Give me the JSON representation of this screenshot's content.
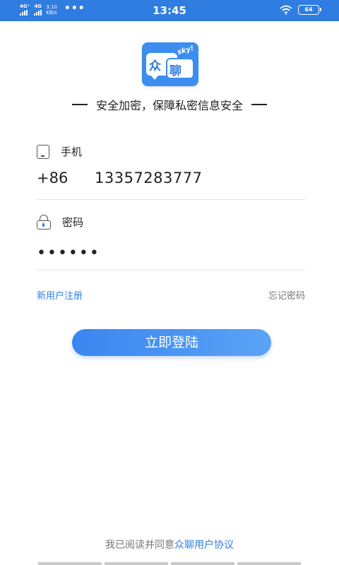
{
  "status_bar": {
    "signal1": "4G⁺",
    "signal2": "4G",
    "net_speed_value": "3.10",
    "net_speed_unit": "KB/s",
    "more": "•••",
    "time": "13:45",
    "battery": "64"
  },
  "logo": {
    "char1": "众",
    "char2": "聊",
    "sky": "sky!"
  },
  "tagline": "安全加密，保障私密信息安全",
  "phone": {
    "label": "手机",
    "country_code": "+86",
    "number": "13357283777"
  },
  "password": {
    "label": "密码",
    "value": "••••••"
  },
  "links": {
    "register": "新用户注册",
    "forgot": "忘记密码"
  },
  "login_button": "立即登陆",
  "agreement": {
    "prefix": "我已阅读并同意",
    "link": "众聊用户协议"
  },
  "colors": {
    "accent": "#2f7de1",
    "status_bar": "#2f7de1"
  }
}
